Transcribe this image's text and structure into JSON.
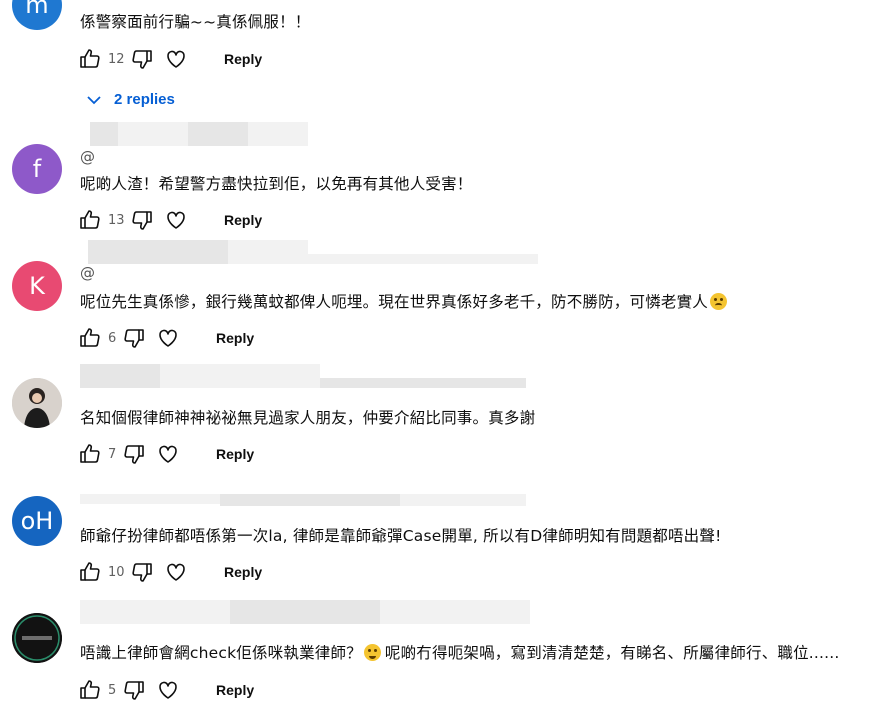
{
  "colors": {
    "link": "#065fd4",
    "text": "#0f0f0f",
    "muted": "#606060"
  },
  "reply_label": "Reply",
  "comments": [
    {
      "avatar_letter": "m",
      "avatar_color": "#1f78d1",
      "text": "係警察面前行騙~~真係佩服！！",
      "likes": "12",
      "replies_label": "2 replies"
    },
    {
      "avatar_letter": "f",
      "avatar_color": "#8e59c9",
      "handle_prefix": "@",
      "text": "呢啲人渣！希望警方盡快拉到佢，以免再有其他人受害！",
      "likes": "13"
    },
    {
      "avatar_letter": "K",
      "avatar_color": "#e84a72",
      "handle_prefix": "@",
      "text": "呢位先生真係慘，銀行幾萬蚊都俾人呃埋。現在世界真係好多老千，防不勝防，可憐老實人",
      "likes": "6"
    },
    {
      "avatar_letter": "",
      "avatar_color": "#cfcfcf",
      "text": "名知個假律師神神祕祕無見過家人朋友，仲要介紹比同事。真多謝",
      "likes": "7"
    },
    {
      "avatar_letter": "oH",
      "avatar_color": "#1565c0",
      "text": "師爺仔扮律師都唔係第一次la, 律師是靠師爺彈Case開單, 所以有D律師明知有問題都唔出聲!",
      "likes": "10"
    },
    {
      "avatar_letter": "",
      "avatar_color": "#151515",
      "text_before_emoji": "唔識上律師會網check佢係咪執業律師？",
      "text_after_emoji": "呢啲冇得呃架喎，寫到清清楚楚，有睇名、所屬律師行、職位......",
      "likes": "5"
    }
  ]
}
